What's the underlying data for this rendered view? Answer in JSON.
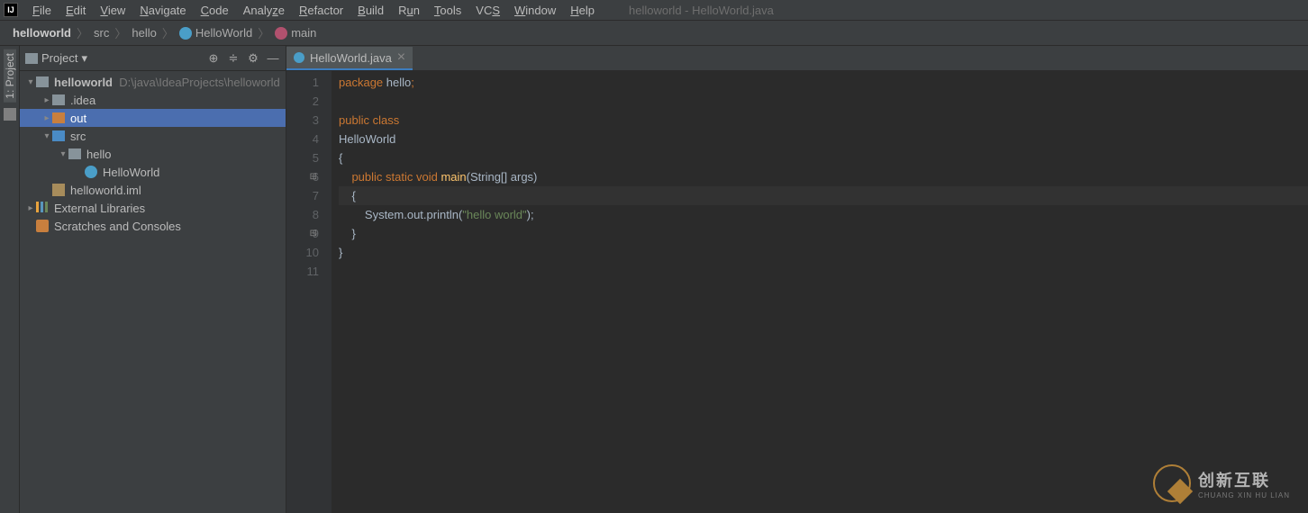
{
  "window_title": "helloworld - HelloWorld.java",
  "menu": [
    "File",
    "Edit",
    "View",
    "Navigate",
    "Code",
    "Analyze",
    "Refactor",
    "Build",
    "Run",
    "Tools",
    "VCS",
    "Window",
    "Help"
  ],
  "breadcrumb": {
    "project": "helloworld",
    "parts": [
      "src",
      "hello"
    ],
    "class": "HelloWorld",
    "method": "main"
  },
  "project_panel": {
    "title": "Project",
    "root": "helloworld",
    "root_path": "D:\\java\\IdeaProjects\\helloworld",
    "nodes": {
      "idea": ".idea",
      "out": "out",
      "src": "src",
      "hello": "hello",
      "helloworld_class": "HelloWorld",
      "iml": "helloworld.iml",
      "ext": "External Libraries",
      "scratch": "Scratches and Consoles"
    }
  },
  "left_tool_label": "1: Project",
  "tab": {
    "name": "HelloWorld.java"
  },
  "code": {
    "l1a": "package ",
    "l1b": "hello",
    "l1c": ";",
    "l3": "public class",
    "l4": "HelloWorld",
    "l5": "{",
    "l6a": "    public static void ",
    "l6b": "main",
    "l6c": "(String[] args)",
    "l7": "    {",
    "l8a": "        System.out.println(",
    "l8b": "\"hello world\"",
    "l8c": ");",
    "l9": "    }",
    "l10": "}"
  },
  "line_numbers": [
    "1",
    "2",
    "3",
    "4",
    "5",
    "6",
    "7",
    "8",
    "9",
    "10",
    "11"
  ],
  "watermark": {
    "main": "创新互联",
    "sub": "CHUANG XIN HU LIAN"
  }
}
